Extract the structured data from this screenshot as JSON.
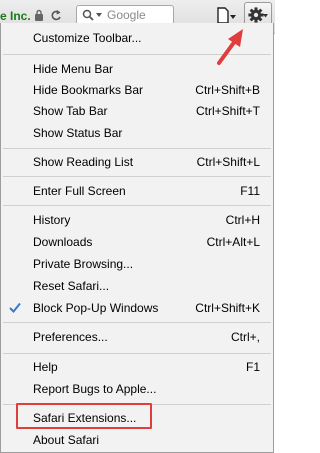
{
  "toolbar": {
    "site_text": "e Inc.",
    "search_placeholder": "Google",
    "accent_color": "#e03d3d"
  },
  "icons": [
    "lock-icon",
    "reload-icon",
    "search-icon",
    "page-icon",
    "gear-icon",
    "checkmark-icon",
    "red-arrow"
  ],
  "menu": {
    "customize_toolbar": "Customize Toolbar...",
    "hide_menu_bar": "Hide Menu Bar",
    "hide_bookmarks_bar": "Hide Bookmarks Bar",
    "hide_bookmarks_bar_shortcut": "Ctrl+Shift+B",
    "show_tab_bar": "Show Tab Bar",
    "show_tab_bar_shortcut": "Ctrl+Shift+T",
    "show_status_bar": "Show Status Bar",
    "show_reading_list": "Show Reading List",
    "show_reading_list_shortcut": "Ctrl+Shift+L",
    "enter_full_screen": "Enter Full Screen",
    "enter_full_screen_shortcut": "F11",
    "history": "History",
    "history_shortcut": "Ctrl+H",
    "downloads": "Downloads",
    "downloads_shortcut": "Ctrl+Alt+L",
    "private_browsing": "Private Browsing...",
    "reset_safari": "Reset Safari...",
    "block_popups": "Block Pop-Up Windows",
    "block_popups_shortcut": "Ctrl+Shift+K",
    "block_popups_checked": true,
    "preferences": "Preferences...",
    "preferences_shortcut": "Ctrl+,",
    "help": "Help",
    "help_shortcut": "F1",
    "report_bugs": "Report Bugs to Apple...",
    "safari_extensions": "Safari Extensions...",
    "about_safari": "About Safari"
  }
}
